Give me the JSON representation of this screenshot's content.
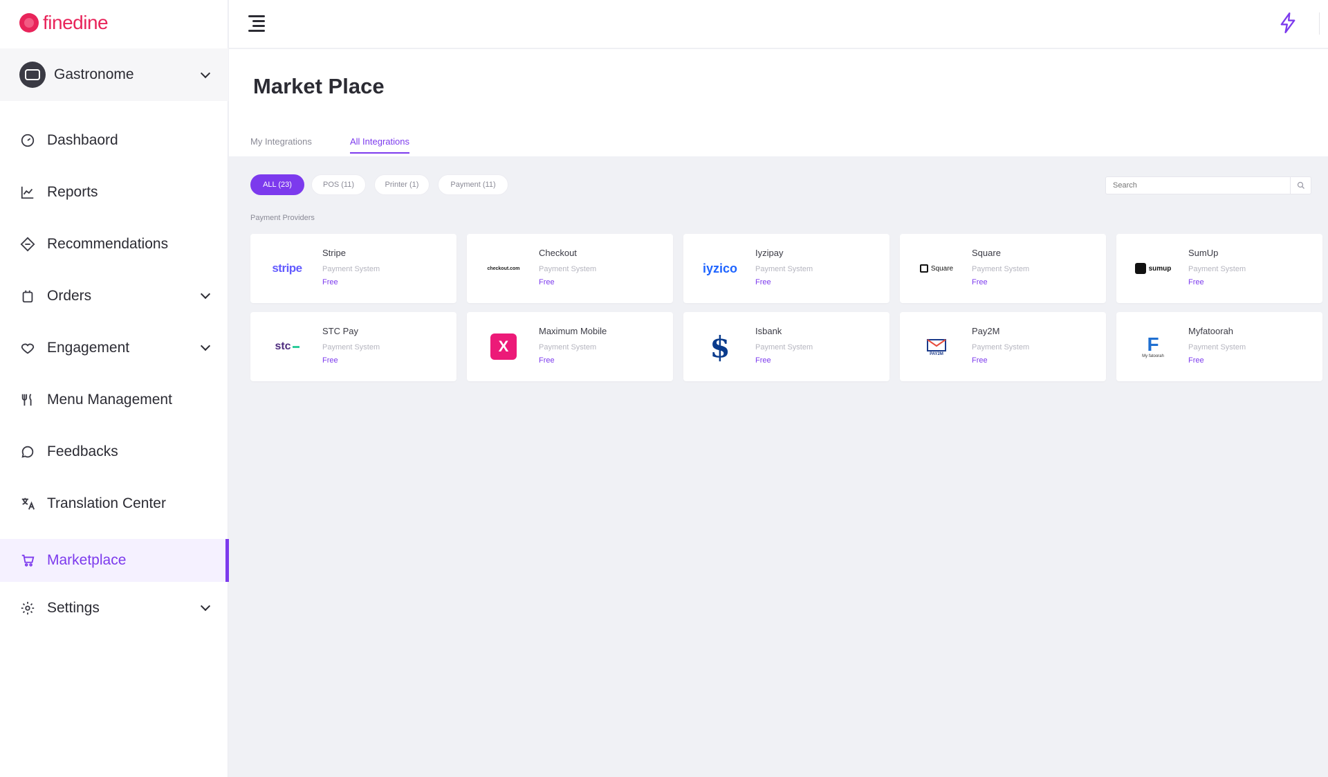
{
  "brand": {
    "name": "finedine",
    "color": "#e8245a"
  },
  "accent": "#7c3aed",
  "venue": {
    "name": "Gastronome"
  },
  "nav": [
    {
      "label": "Dashbaord",
      "icon": "gauge-icon",
      "chevron": false
    },
    {
      "label": "Reports",
      "icon": "line-chart-icon",
      "chevron": false
    },
    {
      "label": "Recommendations",
      "icon": "diamond-icon",
      "chevron": false
    },
    {
      "label": "Orders",
      "icon": "orders-icon",
      "chevron": true
    },
    {
      "label": "Engagement",
      "icon": "heart-icon",
      "chevron": true
    },
    {
      "label": "Menu Management",
      "icon": "cutlery-icon",
      "chevron": false
    },
    {
      "label": "Feedbacks",
      "icon": "chat-icon",
      "chevron": false
    },
    {
      "label": "Translation Center",
      "icon": "translate-icon",
      "chevron": false
    },
    {
      "label": "Marketplace",
      "icon": "cart-icon",
      "chevron": false,
      "active": true
    },
    {
      "label": "Settings",
      "icon": "gear-icon",
      "chevron": true
    }
  ],
  "page": {
    "title": "Market Place"
  },
  "tabs": [
    {
      "label": "My Integrations",
      "active": false
    },
    {
      "label": "All Integrations",
      "active": true
    }
  ],
  "filters": [
    {
      "label": "ALL (23)",
      "active": true
    },
    {
      "label": "POS (11)",
      "active": false
    },
    {
      "label": "Printer (1)",
      "active": false
    },
    {
      "label": "Payment (11)",
      "active": false
    }
  ],
  "search": {
    "placeholder": "Search",
    "value": ""
  },
  "section": {
    "label": "Payment Providers"
  },
  "cards": [
    {
      "name": "Stripe",
      "type": "Payment System",
      "price": "Free",
      "logo": "stripe-logo",
      "logo_text": "stripe"
    },
    {
      "name": "Checkout",
      "type": "Payment System",
      "price": "Free",
      "logo": "checkout-logo",
      "logo_text": "checkout.com"
    },
    {
      "name": "Iyzipay",
      "type": "Payment System",
      "price": "Free",
      "logo": "iyzico-logo",
      "logo_text": "iyzico"
    },
    {
      "name": "Square",
      "type": "Payment System",
      "price": "Free",
      "logo": "square-logo",
      "logo_text": "Square"
    },
    {
      "name": "SumUp",
      "type": "Payment System",
      "price": "Free",
      "logo": "sumup-logo",
      "logo_text": "sumup"
    },
    {
      "name": "STC Pay",
      "type": "Payment System",
      "price": "Free",
      "logo": "stc-pay-logo",
      "logo_text": "stc"
    },
    {
      "name": "Maximum Mobile",
      "type": "Payment System",
      "price": "Free",
      "logo": "maximum-mobile-logo",
      "logo_text": "X"
    },
    {
      "name": "Isbank",
      "type": "Payment System",
      "price": "Free",
      "logo": "isbank-logo",
      "logo_text": "$"
    },
    {
      "name": "Pay2M",
      "type": "Payment System",
      "price": "Free",
      "logo": "pay2m-logo",
      "logo_text": "PAY2M"
    },
    {
      "name": "Myfatoorah",
      "type": "Payment System",
      "price": "Free",
      "logo": "myfatoorah-logo",
      "logo_text": "My fatoorah"
    }
  ]
}
